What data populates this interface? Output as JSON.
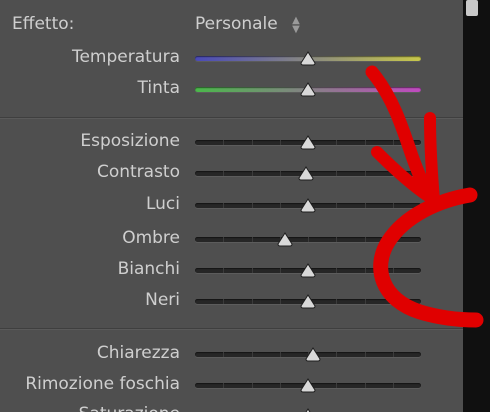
{
  "effect": {
    "label": "Effetto:",
    "value": "Personale",
    "arrow_icon": "updown-arrows-icon"
  },
  "sliders": [
    {
      "id": "temperatura",
      "label": "Temperatura",
      "value": 0.5,
      "track": "temperature"
    },
    {
      "id": "tinta",
      "label": "Tinta",
      "value": 0.5,
      "track": "tint"
    },
    {
      "id": "esposizione",
      "label": "Esposizione",
      "value": 0.5,
      "track": "plain"
    },
    {
      "id": "contrasto",
      "label": "Contrasto",
      "value": 0.49,
      "track": "plain"
    },
    {
      "id": "luci",
      "label": "Luci",
      "value": 0.5,
      "track": "plain"
    },
    {
      "id": "ombre",
      "label": "Ombre",
      "value": 0.4,
      "track": "plain"
    },
    {
      "id": "bianchi",
      "label": "Bianchi",
      "value": 0.5,
      "track": "plain"
    },
    {
      "id": "neri",
      "label": "Neri",
      "value": 0.5,
      "track": "plain"
    },
    {
      "id": "chiarezza",
      "label": "Chiarezza",
      "value": 0.52,
      "track": "plain"
    },
    {
      "id": "rimozione-foschia",
      "label": "Rimozione foschia",
      "value": 0.5,
      "track": "plain"
    },
    {
      "id": "saturazione",
      "label": "Saturazione",
      "value": 0.5,
      "track": "plain"
    }
  ],
  "colors": {
    "temperature_start": "#4a4ab8",
    "temperature_end": "#c8c84a",
    "tint_start": "#4ab84a",
    "tint_end": "#c04ac0",
    "annotation": "#e00000"
  }
}
